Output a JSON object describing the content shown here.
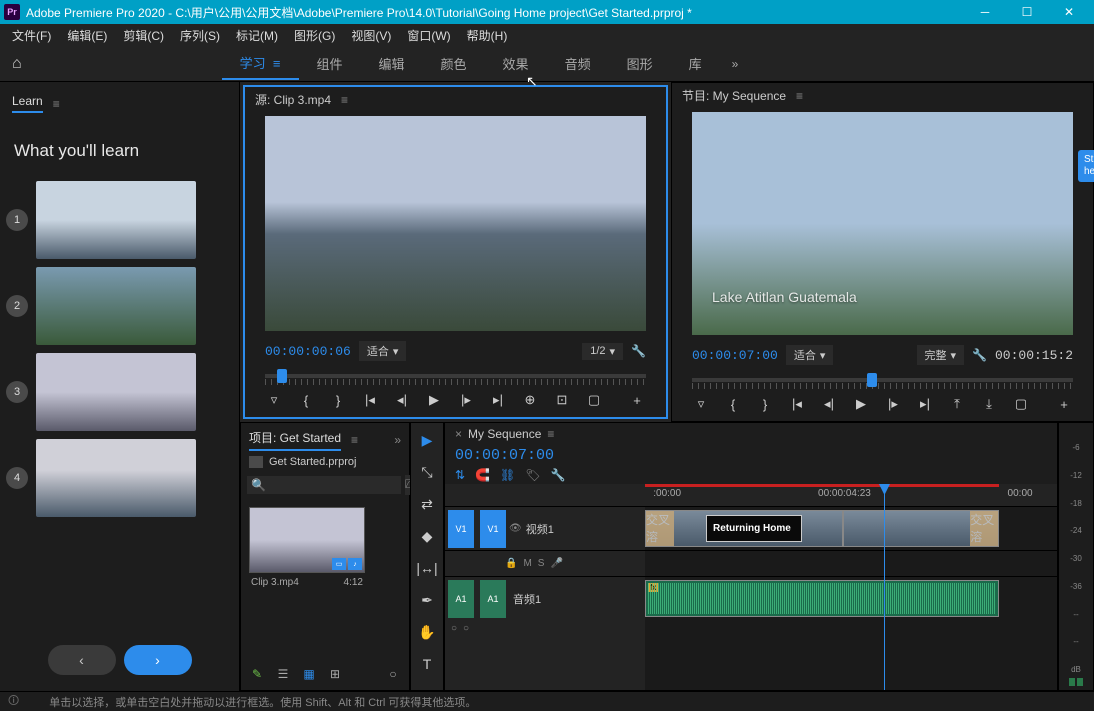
{
  "titlebar": {
    "app": "Pr",
    "title": "Adobe Premiere Pro 2020 - C:\\用户\\公用\\公用文档\\Adobe\\Premiere Pro\\14.0\\Tutorial\\Going Home project\\Get Started.prproj *"
  },
  "menus": [
    "文件(F)",
    "编辑(E)",
    "剪辑(C)",
    "序列(S)",
    "标记(M)",
    "图形(G)",
    "视图(V)",
    "窗口(W)",
    "帮助(H)"
  ],
  "workspaces": {
    "items": [
      "学习",
      "组件",
      "编辑",
      "颜色",
      "效果",
      "音频",
      "图形",
      "库"
    ],
    "active": "学习"
  },
  "learn": {
    "tab": "Learn",
    "heading": "What you'll learn",
    "tip": "St\nhe"
  },
  "source": {
    "title": "源: Clip 3.mp4",
    "tc_in": "00:00:00:06",
    "fit": "适合",
    "zoom": "1/2"
  },
  "program": {
    "title": "节目: My Sequence",
    "tc_in": "00:00:07:00",
    "fit": "适合",
    "quality": "完整",
    "tc_out": "00:00:15:2",
    "overlay": "Lake Atitlan\nGuatemala"
  },
  "project": {
    "tab": "项目: Get Started",
    "file": "Get Started.prproj",
    "clip_name": "Clip 3.mp4",
    "clip_dur": "4:12"
  },
  "timeline": {
    "tab": "My Sequence",
    "tc": "00:00:07:00",
    "ruler": [
      ":00:00",
      "00:00:04:23",
      "00:00"
    ],
    "v1": "V1",
    "a1": "A1",
    "video_label": "视频1",
    "audio_label": "音频1",
    "title_clip": "Returning Home",
    "togs": {
      "m": "M",
      "s": "S"
    },
    "fx_badge": "fx",
    "handle_label": "交叉溶"
  },
  "meter": {
    "marks": [
      "-6",
      "-12",
      "-18",
      "-24",
      "-30",
      "-36",
      "--",
      "--",
      "dB"
    ]
  },
  "statusbar": {
    "text": "单击以选择，或单击空白处并拖动以进行框选。使用 Shift、Alt 和 Ctrl 可获得其他选项。"
  }
}
